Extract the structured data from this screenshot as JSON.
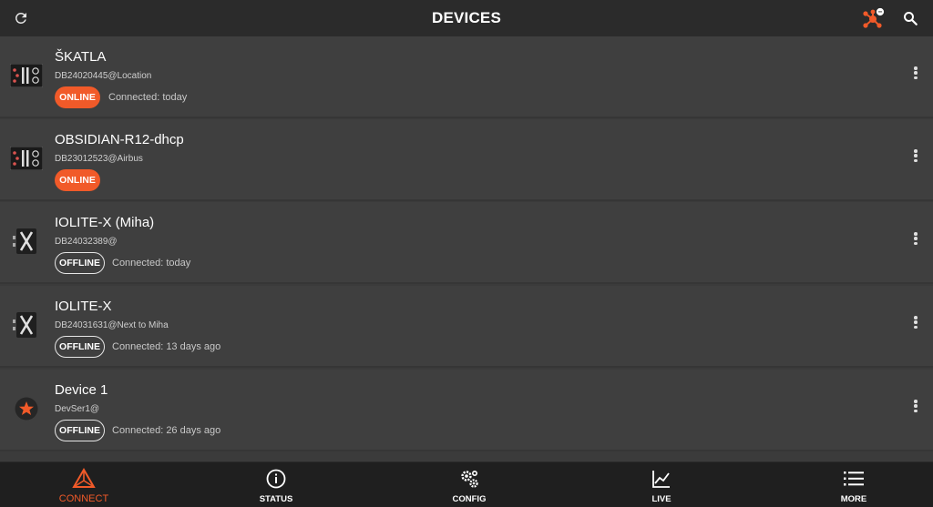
{
  "header": {
    "title": "DEVICES",
    "hub_badge": "−"
  },
  "devices": [
    {
      "name": "ŠKATLA",
      "serial": "DB24020445@Location",
      "status": "ONLINE",
      "connected": "Connected: today",
      "icon": "device-box-icon"
    },
    {
      "name": "OBSIDIAN-R12-dhcp",
      "serial": "DB23012523@Airbus",
      "status": "ONLINE",
      "connected": "",
      "icon": "device-box-icon"
    },
    {
      "name": "IOLITE-X (Miha)",
      "serial": "DB24032389@",
      "status": "OFFLINE",
      "connected": "Connected: today",
      "icon": "iolite-x-icon"
    },
    {
      "name": "IOLITE-X",
      "serial": "DB24031631@Next to Miha",
      "status": "OFFLINE",
      "connected": "Connected: 13 days ago",
      "icon": "iolite-x-icon"
    },
    {
      "name": "Device 1",
      "serial": "DevSer1@",
      "status": "OFFLINE",
      "connected": "Connected: 26 days ago",
      "icon": "star-device-icon"
    }
  ],
  "nav": [
    {
      "label": "CONNECT",
      "icon": "connect-icon",
      "active": true
    },
    {
      "label": "STATUS",
      "icon": "info-icon",
      "active": false
    },
    {
      "label": "CONFIG",
      "icon": "gears-icon",
      "active": false
    },
    {
      "label": "LIVE",
      "icon": "chart-icon",
      "active": false
    },
    {
      "label": "MORE",
      "icon": "menu-icon",
      "active": false
    }
  ],
  "colors": {
    "accent": "#f15a29",
    "background": "#3b3b3b",
    "bar": "#2b2b2b"
  }
}
